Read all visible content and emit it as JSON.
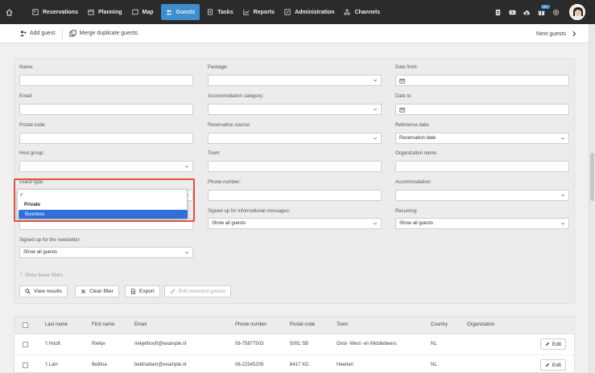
{
  "nav": {
    "items": [
      {
        "label": "Reservations",
        "icon": "calendar-grid-icon"
      },
      {
        "label": "Planning",
        "icon": "planning-icon"
      },
      {
        "label": "Map",
        "icon": "map-icon"
      },
      {
        "label": "Guests",
        "icon": "users-icon",
        "active": true
      },
      {
        "label": "Tasks",
        "icon": "tasks-icon"
      },
      {
        "label": "Reports",
        "icon": "chart-icon"
      },
      {
        "label": "Administration",
        "icon": "admin-icon"
      },
      {
        "label": "Channels",
        "icon": "channels-icon"
      }
    ],
    "badge": "99+",
    "accent": "#3d8ed0"
  },
  "toolbar": {
    "add_guest": "Add guest",
    "merge": "Merge duplicate guests",
    "next": "Next guests"
  },
  "filters": {
    "name": "Name:",
    "package": "Package:",
    "date_from": "Date from:",
    "email": "Email:",
    "accommodation_category": "Accommodation category:",
    "date_to": "Date to:",
    "postal_code": "Postal code:",
    "reservation_source": "Reservation source:",
    "reference_date": "Reference date:",
    "reference_date_value": "Reservation date",
    "host_group": "Host group:",
    "town": "Town:",
    "organization_name": "Organization name:",
    "guest_type": "Guest type:",
    "phone_number": "Phone number:",
    "accommodation": "Accommodation:",
    "informational_messages": "Signed up for informational messages:",
    "informational_messages_value": "Show all guests",
    "recurring": "Recurring:",
    "recurring_value": "Show all guests",
    "newsletter": "Signed up for the newsletter:",
    "newsletter_value": "Show all guests",
    "show_fewer": "Show fewer filters"
  },
  "guest_type_dropdown": {
    "check": "✓",
    "options": [
      "Private",
      "Business"
    ],
    "selected": "Business",
    "highlight_color": "#2e6fd8",
    "frame_color": "#e0533f"
  },
  "actions": {
    "view_results": "View results",
    "clear_filter": "Clear filter",
    "export": "Export",
    "edit_selected": "Edit selected guests"
  },
  "table": {
    "headers": [
      "Last name",
      "First name",
      "Email",
      "Phone number",
      "Postal code",
      "Town",
      "Country",
      "Organization"
    ],
    "rows": [
      {
        "last": "'t Hooft",
        "first": "Riekje",
        "email": "riekjethooft@example.nl",
        "phone": "06-75877503",
        "postal": "5091 SB",
        "town": "Oost- West- en Middelbeers",
        "country": "NL",
        "org": ""
      },
      {
        "last": "'t Lam",
        "first": "Bettina",
        "email": "bettinatlam@example.nl",
        "phone": "06-22545209",
        "postal": "6417 XD",
        "town": "Heerlen",
        "country": "NL",
        "org": ""
      }
    ],
    "edit_label": "Edit"
  }
}
